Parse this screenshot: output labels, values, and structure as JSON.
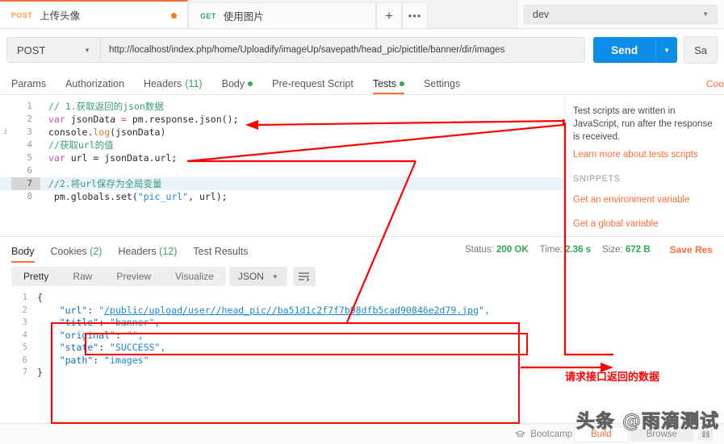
{
  "tabbar": {
    "tabs": [
      {
        "method": "POST",
        "title": "上传头像",
        "unsaved": true
      },
      {
        "method": "GET",
        "title": "使用图片",
        "unsaved": false
      }
    ],
    "new_tab_label": "+",
    "more_label": "•••",
    "environment": {
      "value": "dev",
      "caret": "▼"
    }
  },
  "urlbar": {
    "method": "POST",
    "method_caret": "▼",
    "url": "http://localhost/index.php/home/Uploadify/imageUp/savepath/head_pic/pictitle/banner/dir/images",
    "send_label": "Send",
    "send_caret": "▼",
    "save_label": "Sa"
  },
  "request_tabs": {
    "items": [
      {
        "label": "Params",
        "count": "",
        "dot": false,
        "active": false
      },
      {
        "label": "Authorization",
        "count": "",
        "dot": false,
        "active": false
      },
      {
        "label": "Headers",
        "count": "(11)",
        "dot": false,
        "active": false
      },
      {
        "label": "Body",
        "count": "",
        "dot": true,
        "active": false
      },
      {
        "label": "Pre-request Script",
        "count": "",
        "dot": false,
        "active": false
      },
      {
        "label": "Tests",
        "count": "",
        "dot": true,
        "active": true
      },
      {
        "label": "Settings",
        "count": "",
        "dot": false,
        "active": false
      }
    ],
    "cookies_link": "Coo"
  },
  "editor": {
    "lines": [
      {
        "n": "1",
        "breakpoint": "",
        "highlight": false,
        "tokens": [
          {
            "t": "// 1.获取返回的json数据",
            "c": "c-com"
          }
        ]
      },
      {
        "n": "2",
        "breakpoint": "",
        "highlight": false,
        "tokens": [
          {
            "t": "var ",
            "c": "c-kw"
          },
          {
            "t": "jsonData ",
            "c": "c-var"
          },
          {
            "t": "= ",
            "c": "c-kw"
          },
          {
            "t": "pm.response.json();",
            "c": "c-pl"
          }
        ]
      },
      {
        "n": "3",
        "breakpoint": "i",
        "highlight": false,
        "tokens": [
          {
            "t": "console.",
            "c": "c-pl"
          },
          {
            "t": "log",
            "c": "c-fn"
          },
          {
            "t": "(jsonData)",
            "c": "c-pl"
          }
        ]
      },
      {
        "n": "4",
        "breakpoint": "",
        "highlight": false,
        "tokens": [
          {
            "t": "//获取url的值",
            "c": "c-com"
          }
        ]
      },
      {
        "n": "5",
        "breakpoint": "",
        "highlight": false,
        "tokens": [
          {
            "t": "var ",
            "c": "c-kw"
          },
          {
            "t": "url = jsonData.url;",
            "c": "c-pl"
          }
        ]
      },
      {
        "n": "6",
        "breakpoint": "",
        "highlight": false,
        "tokens": [
          {
            "t": " ",
            "c": "c-pl"
          }
        ]
      },
      {
        "n": "7",
        "breakpoint": "",
        "highlight": true,
        "tokens": [
          {
            "t": "//2.将url保存为全局变量",
            "c": "c-com"
          }
        ]
      },
      {
        "n": "8",
        "breakpoint": "",
        "highlight": false,
        "tokens": [
          {
            "t": " pm.globals.set(",
            "c": "c-pl"
          },
          {
            "t": "\"pic_url\"",
            "c": "c-str"
          },
          {
            "t": ", url);",
            "c": "c-pl"
          }
        ]
      }
    ]
  },
  "sidebar_help": {
    "description": "Test scripts are written in JavaScript, run after the response is received.",
    "learn_more": "Learn more about tests scripts",
    "snippets_title": "SNIPPETS",
    "snippets": [
      "Get an environment variable",
      "Get a global variable"
    ]
  },
  "response": {
    "tabs": [
      {
        "label": "Body",
        "count": "",
        "active": true
      },
      {
        "label": "Cookies",
        "count": "(2)",
        "active": false
      },
      {
        "label": "Headers",
        "count": "(12)",
        "active": false
      },
      {
        "label": "Test Results",
        "count": "",
        "active": false
      }
    ],
    "status_label": "Status:",
    "status_value": "200 OK",
    "time_label": "Time:",
    "time_value": "2.36 s",
    "size_label": "Size:",
    "size_value": "672 B",
    "save_response": "Save Res",
    "format_tabs": [
      "Pretty",
      "Raw",
      "Preview",
      "Visualize"
    ],
    "format_active": "Pretty",
    "language": "JSON",
    "language_caret": "▼",
    "wrap_icon": "wrap-lines-icon",
    "body_lines": [
      {
        "n": "1",
        "tokens": [
          {
            "t": "{",
            "c": "j-pun"
          }
        ]
      },
      {
        "n": "2",
        "tokens": [
          {
            "t": "    ",
            "c": "j-pun"
          },
          {
            "t": "\"url\"",
            "c": "j-key"
          },
          {
            "t": ": ",
            "c": "j-pun"
          },
          {
            "t": "\"",
            "c": "j-str"
          },
          {
            "t": "/public/upload/user//head_pic//ba51d1c2f7f7b98dfb5cad90846e2d79.jpg",
            "c": "j-url"
          },
          {
            "t": "\",",
            "c": "j-str"
          }
        ]
      },
      {
        "n": "3",
        "tokens": [
          {
            "t": "    ",
            "c": "j-pun"
          },
          {
            "t": "\"title\"",
            "c": "j-key"
          },
          {
            "t": ": ",
            "c": "j-pun"
          },
          {
            "t": "\"banner\",",
            "c": "j-str"
          }
        ]
      },
      {
        "n": "4",
        "tokens": [
          {
            "t": "    ",
            "c": "j-pun"
          },
          {
            "t": "\"original\"",
            "c": "j-key"
          },
          {
            "t": ": ",
            "c": "j-pun"
          },
          {
            "t": "\"\",",
            "c": "j-str"
          }
        ]
      },
      {
        "n": "5",
        "tokens": [
          {
            "t": "    ",
            "c": "j-pun"
          },
          {
            "t": "\"state\"",
            "c": "j-key"
          },
          {
            "t": ": ",
            "c": "j-pun"
          },
          {
            "t": "\"SUCCESS\",",
            "c": "j-str"
          }
        ]
      },
      {
        "n": "6",
        "tokens": [
          {
            "t": "    ",
            "c": "j-pun"
          },
          {
            "t": "\"path\"",
            "c": "j-key"
          },
          {
            "t": ": ",
            "c": "j-pun"
          },
          {
            "t": "\"images\"",
            "c": "j-str"
          }
        ]
      },
      {
        "n": "7",
        "tokens": [
          {
            "t": "}",
            "c": "j-pun"
          }
        ]
      }
    ]
  },
  "footer": {
    "bootcamp": "Bootcamp",
    "build": "Build",
    "browse": "Browse"
  },
  "annotations": {
    "callout_text": "请求接口返回的数据",
    "color": "#ff0000"
  },
  "watermark": {
    "text": "头条 @雨滴测试"
  }
}
